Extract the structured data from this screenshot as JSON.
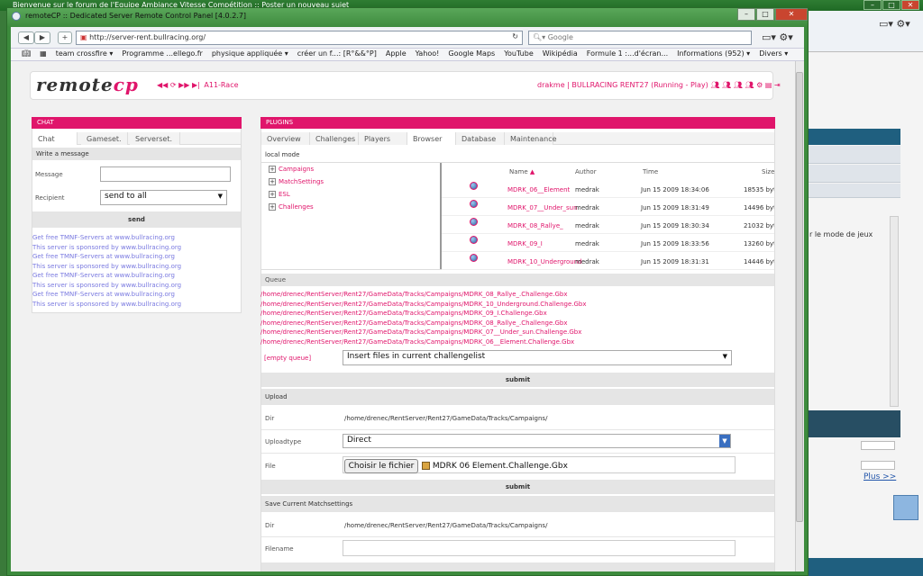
{
  "background_window": {
    "title": "Bienvenue sur le forum de l'Equipe Ambiance Vitesse Compétition :: Poster un nouveau sujet",
    "partial_text": "r le mode de jeux",
    "more_link": "Plus >>"
  },
  "window": {
    "title": "remoteCP :: Dedicated Server Remote Control Panel [4.0.2.7]"
  },
  "browser": {
    "url": "http://server-rent.bullracing.org/",
    "search_placeholder": "Google",
    "bookmarks": [
      "team crossfire ▾",
      "Programme ...ellego.fr",
      "physique appliquée ▾",
      "créer un f...: [R°&&°P]",
      "Apple",
      "Yahoo!",
      "Google Maps",
      "YouTube",
      "Wikipédia",
      "Formule 1 :...d'écran...",
      "Informations (952) ▾",
      "Divers ▾"
    ]
  },
  "header": {
    "logo_main": "remote",
    "logo_accent": "cp",
    "server_name": "A11-Race",
    "status": "drakme | BULLRACING RENT27 (Running - Play)"
  },
  "chat": {
    "title": "CHAT",
    "tabs": [
      "Chat",
      "Gameset.",
      "Serverset."
    ],
    "write_label": "Write a message",
    "message_label": "Message",
    "recipient_label": "Recipient",
    "recipient_value": "send to all",
    "send_label": "send",
    "lines": [
      "Get free TMNF-Servers at www.bullracing.org",
      "This server is sponsored by www.bullracing.org",
      "Get free TMNF-Servers at www.bullracing.org",
      "This server is sponsored by www.bullracing.org",
      "Get free TMNF-Servers at www.bullracing.org",
      "This server is sponsored by www.bullracing.org",
      "Get free TMNF-Servers at www.bullracing.org",
      "This server is sponsored by www.bullracing.org"
    ]
  },
  "plugins": {
    "title": "PLUGINS",
    "tabs": [
      "Overview",
      "Challenges",
      "Players",
      "Browser",
      "Database",
      "Maintenance"
    ],
    "local_mode": "local mode",
    "tree": [
      "Campaigns",
      "MatchSettings",
      "ESL",
      "Challenges"
    ],
    "columns": [
      "Name",
      "Author",
      "Time",
      "Size"
    ],
    "files": [
      {
        "name": "MDRK_06__Element",
        "author": "medrak",
        "time": "Jun 15 2009 18:34:06",
        "size": "18535 byte"
      },
      {
        "name": "MDRK_07__Under_sun",
        "author": "medrak",
        "time": "Jun 15 2009 18:31:49",
        "size": "14496 byte"
      },
      {
        "name": "MDRK_08_Rallye_",
        "author": "medrak",
        "time": "Jun 15 2009 18:30:34",
        "size": "21032 byte"
      },
      {
        "name": "MDRK_09_I",
        "author": "medrak",
        "time": "Jun 15 2009 18:33:56",
        "size": "13260 byte"
      },
      {
        "name": "MDRK_10_Underground",
        "author": "medrak",
        "time": "Jun 15 2009 18:31:31",
        "size": "14446 byte"
      }
    ],
    "queue_label": "Queue",
    "queue": [
      "/home/drenec/RentServer/Rent27/GameData/Tracks/Campaigns/MDRK_08_Rallye_.Challenge.Gbx",
      "/home/drenec/RentServer/Rent27/GameData/Tracks/Campaigns/MDRK_10_Underground.Challenge.Gbx",
      "/home/drenec/RentServer/Rent27/GameData/Tracks/Campaigns/MDRK_09_I.Challenge.Gbx",
      "/home/drenec/RentServer/Rent27/GameData/Tracks/Campaigns/MDRK_08_Rallye_.Challenge.Gbx",
      "/home/drenec/RentServer/Rent27/GameData/Tracks/Campaigns/MDRK_07__Under_sun.Challenge.Gbx",
      "/home/drenec/RentServer/Rent27/GameData/Tracks/Campaigns/MDRK_06__Element.Challenge.Gbx"
    ],
    "empty_queue": "[empty queue]",
    "queue_action": "Insert files in current challengelist",
    "submit": "submit",
    "upload_label": "Upload",
    "dir_label": "Dir",
    "dir_value": "/home/drenec/RentServer/Rent27/GameData/Tracks/Campaigns/",
    "uploadtype_label": "Uploadtype",
    "uploadtype_value": "Direct",
    "file_label": "File",
    "file_button": "Choisir le fichier",
    "file_name": "MDRK 06  Element.Challenge.Gbx",
    "save_label": "Save Current Matchsettings",
    "filename_label": "Filename"
  }
}
